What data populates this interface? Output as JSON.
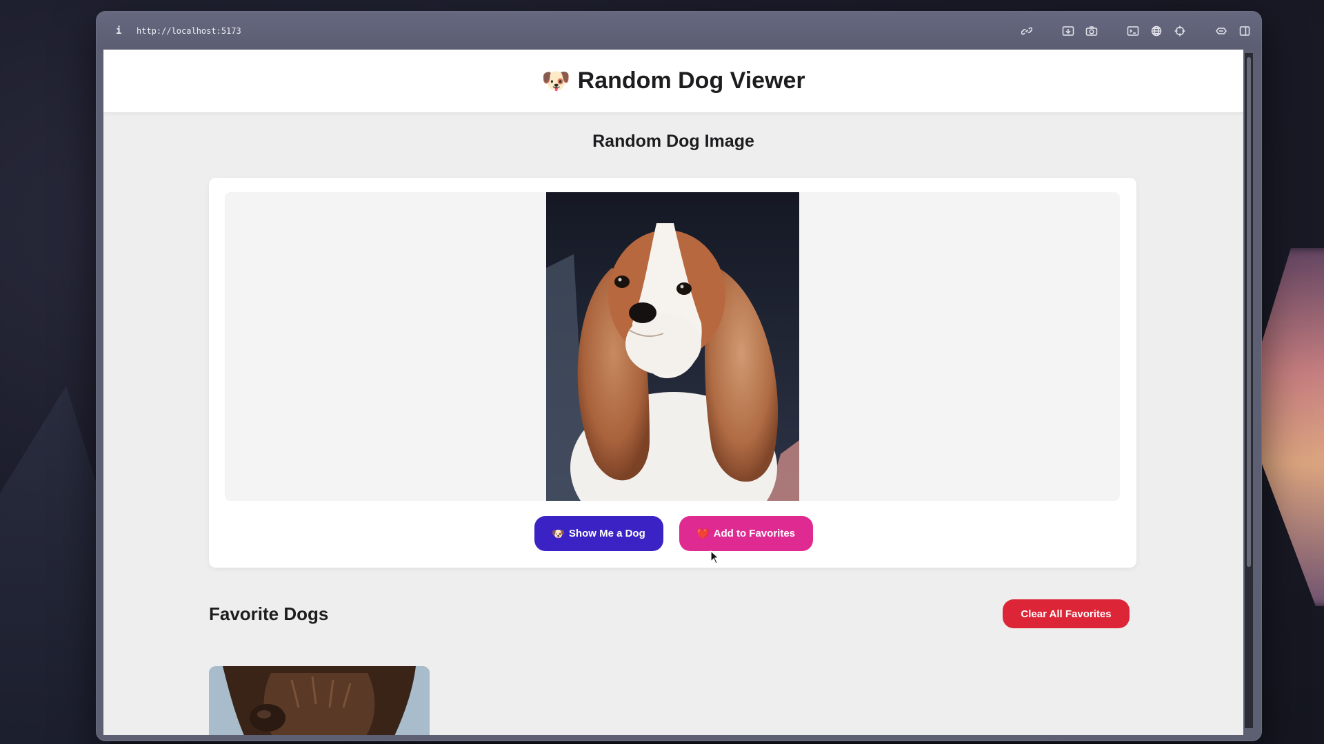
{
  "browser": {
    "url": "http://localhost:5173",
    "toolbar_icons": [
      "link-icon",
      "screenshot-icon",
      "camera-icon",
      "terminal-icon",
      "globe-icon",
      "crosshair-icon",
      "extension-icon",
      "sidebar-icon"
    ]
  },
  "app": {
    "title_emoji": "🐶",
    "title": "Random Dog Viewer"
  },
  "viewer": {
    "heading": "Random Dog Image",
    "show_button": {
      "emoji": "🐶",
      "label": "Show Me a Dog"
    },
    "favorite_button": {
      "emoji": "❤️",
      "label": "Add to Favorites"
    }
  },
  "favorites": {
    "heading": "Favorite Dogs",
    "clear_button": "Clear All Favorites"
  },
  "colors": {
    "primary": "#3a22c4",
    "favorite": "#df2a92",
    "danger": "#dc2637"
  }
}
